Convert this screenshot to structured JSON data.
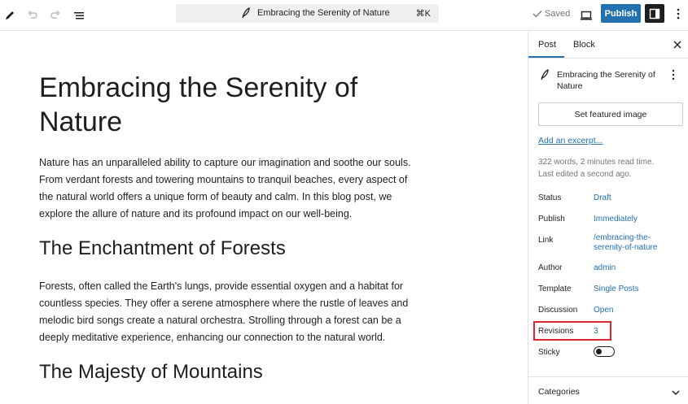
{
  "toolbar": {
    "command_title": "Embracing the Serenity of Nature",
    "shortcut": "⌘K",
    "saved_label": "Saved",
    "publish_label": "Publish"
  },
  "post": {
    "title": "Embracing the Serenity of Nature",
    "intro": "Nature has an unparalleled ability to capture our imagination and soothe our souls. From verdant forests and towering mountains to tranquil beaches, every aspect of the natural world offers a unique form of beauty and calm. In this blog post, we explore the allure of nature and its profound impact on our well-being.",
    "heading_1": "The Enchantment of Forests",
    "paragraph_1": "Forests, often called the Earth's lungs, provide essential oxygen and a habitat for countless species. They offer a serene atmosphere where the rustle of leaves and melodic bird songs create a natural orchestra. Strolling through a forest can be a deeply meditative experience, enhancing our connection to the natural world.",
    "heading_2": "The Majesty of Mountains"
  },
  "sidebar": {
    "tabs": [
      "Post",
      "Block"
    ],
    "doc_title": "Embracing the Serenity of Nature",
    "featured_image_label": "Set featured image",
    "excerpt_link": "Add an excerpt...",
    "word_count": "322 words, 2 minutes read time.",
    "last_edited": "Last edited a second ago.",
    "rows": [
      {
        "label": "Status",
        "value": "Draft"
      },
      {
        "label": "Publish",
        "value": "Immediately"
      },
      {
        "label": "Link",
        "value": "/embracing-the-serenity-of-nature"
      },
      {
        "label": "Author",
        "value": "admin"
      },
      {
        "label": "Template",
        "value": "Single Posts"
      },
      {
        "label": "Discussion",
        "value": "Open"
      },
      {
        "label": "Revisions",
        "value": "3"
      },
      {
        "label": "Sticky",
        "value": ""
      }
    ],
    "sticky_on": false,
    "categories_label": "Categories"
  },
  "colors": {
    "accent": "#2271b1",
    "highlight": "#e0262b"
  }
}
